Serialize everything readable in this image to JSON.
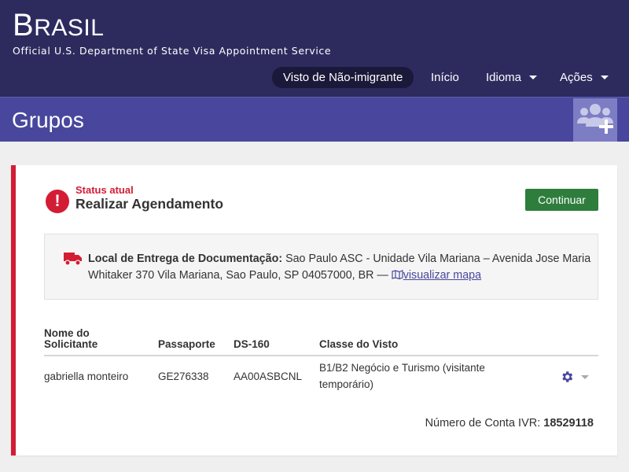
{
  "header": {
    "brand_first": "B",
    "brand_rest": "RASIL",
    "tagline": "Official U.S. Department of State Visa Appointment Service",
    "nav": {
      "active": "Visto de Não-imigrante",
      "inicio": "Início",
      "idioma": "Idioma",
      "acoes": "Ações"
    }
  },
  "groups": {
    "title": "Grupos"
  },
  "status": {
    "label": "Status atual",
    "value": "Realizar Agendamento",
    "icon": "!",
    "continue_label": "Continuar"
  },
  "delivery": {
    "label": "Local de Entrega de Documentação:",
    "address": "Sao Paulo ASC - Unidade Vila Mariana – Avenida Jose Maria Whitaker 370 Vila Mariana, Sao Paulo, SP 04057000, BR —",
    "map_link": "visualizar mapa"
  },
  "table": {
    "headers": {
      "name_line1": "Nome do",
      "name_line2": "Solicitante",
      "passport": "Passaporte",
      "ds160": "DS-160",
      "visa_class": "Classe do Visto"
    },
    "rows": [
      {
        "name": "gabriella monteiro",
        "passport": "GE276338",
        "ds160": "AA00ASBCNL",
        "visa_class": "B1/B2 Negócio e Turismo (visitante temporário)"
      }
    ]
  },
  "ivr": {
    "label": "Número de Conta IVR:",
    "value": "18529118"
  },
  "colors": {
    "header_bg": "#2d2b5e",
    "group_bar_bg": "#48479d",
    "alert_red": "#d31d35",
    "button_green": "#2e7d3d",
    "link": "#48479d"
  }
}
